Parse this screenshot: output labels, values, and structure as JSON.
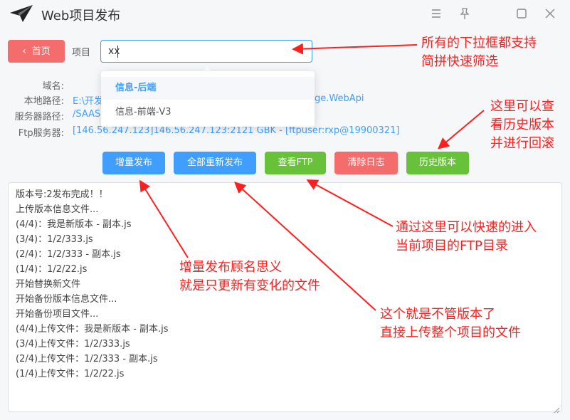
{
  "app": {
    "title": "Web项目发布",
    "icons": {
      "logo": "paper-plane-icon",
      "menu": "hamburger-icon",
      "pin": "pin-icon",
      "maximize": "square-icon",
      "close": "close-icon"
    }
  },
  "toolbar": {
    "home_label": "首页",
    "project_label": "项目",
    "project_value": "xx"
  },
  "dropdown": {
    "options": [
      "信息-后端",
      "信息-前端-V3"
    ],
    "selected_index": 0
  },
  "info": {
    "domain_label": "域名:",
    "domain_value": "",
    "local_label": "本地路径:",
    "local_value_left": "E:\\开发",
    "local_value_right": "ge.WebApi",
    "server_label": "服务器路径:",
    "server_value": "/SAAS",
    "ftp_label": "Ftp服务器:",
    "ftp_value": "[146.56.247.123]146.56.247.123:2121 GBK - [ftpuser:rxp@19900321]"
  },
  "actions": {
    "incremental": "增量发布",
    "republish_all": "全部重新发布",
    "view_ftp": "查看FTP",
    "clear_log": "清除日志",
    "history": "历史版本",
    "colors": {
      "primary": "#409eff",
      "success": "#67c23a",
      "danger": "#f56c6c"
    }
  },
  "log": {
    "lines": [
      "版本号:2发布完成！！",
      "上传版本信息文件...",
      "(4/4)：我是新版本 - 副本.js",
      "(3/4)：1/2/333.js",
      "(2/4)：1/2/333 - 副本.js",
      "(1/4)：1/2/22.js",
      "开始替换新文件",
      "开始备份版本信息文件...",
      "开始备份项目文件...",
      "(4/4)上传文件：我是新版本 - 副本.js",
      "(3/4)上传文件：1/2/333.js",
      "(2/4)上传文件：1/2/333 - 副本.js",
      "(1/4)上传文件：1/2/22.js"
    ]
  },
  "annotations": {
    "dropdown_note_1": "所有的下拉框都支持",
    "dropdown_note_2": "简拼快速筛选",
    "history_note_1": "这里可以查",
    "history_note_2": "看历史版本",
    "history_note_3": "并进行回滚",
    "ftp_note_1": "通过这里可以快速的进入",
    "ftp_note_2": "当前项目的FTP目录",
    "incremental_note_1": "增量发布顾名思义",
    "incremental_note_2": "就是只更新有变化的文件",
    "republish_note_1": "这个就是不管版本了",
    "republish_note_2": "直接上传整个项目的文件",
    "color": "#ff1f1f"
  }
}
